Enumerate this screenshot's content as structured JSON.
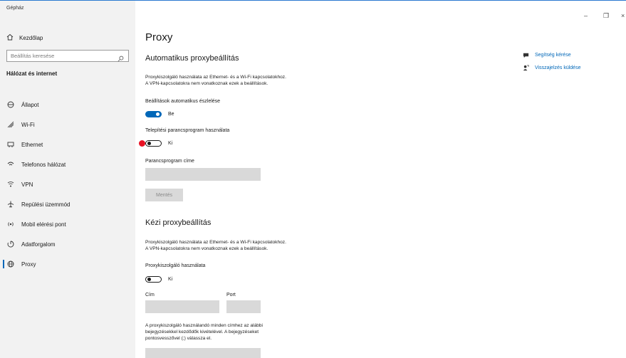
{
  "window": {
    "title": "Gépház",
    "minimize": "–",
    "restore": "❐",
    "close": "×"
  },
  "sidebar": {
    "home_label": "Kezdőlap",
    "search_placeholder": "Beállítás keresése",
    "section_title": "Hálózat és internet",
    "items": [
      {
        "label": "Állapot",
        "icon": "status-icon"
      },
      {
        "label": "Wi-Fi",
        "icon": "wifi-icon"
      },
      {
        "label": "Ethernet",
        "icon": "ethernet-icon"
      },
      {
        "label": "Telefonos hálózat",
        "icon": "dialup-icon"
      },
      {
        "label": "VPN",
        "icon": "vpn-icon"
      },
      {
        "label": "Repülési üzemmód",
        "icon": "airplane-icon"
      },
      {
        "label": "Mobil elérési pont",
        "icon": "hotspot-icon"
      },
      {
        "label": "Adatforgalom",
        "icon": "data-usage-icon"
      },
      {
        "label": "Proxy",
        "icon": "globe-icon",
        "selected": true
      }
    ]
  },
  "main": {
    "title": "Proxy",
    "auto": {
      "heading": "Automatikus proxybeállítás",
      "desc1": "Proxykiszolgáló használata az Ethernet- és a Wi-Fi kapcsolatokhoz.",
      "desc2": "A VPN-kapcsolatokra nem vonatkoznak ezek a beállítások.",
      "detect_label": "Beállítások automatikus észlelése",
      "detect_state": "Be",
      "script_label": "Telepítési parancsprogram használata",
      "script_state": "Ki",
      "address_label": "Parancsprogram címe",
      "save_label": "Mentés"
    },
    "manual": {
      "heading": "Kézi proxybeállítás",
      "desc1": "Proxykiszolgáló használata az Ethernet- és a Wi-Fi kapcsolatokhoz.",
      "desc2": "A VPN-kapcsolatokra nem vonatkoznak ezek a beállítások.",
      "use_label": "Proxykiszolgáló használata",
      "use_state": "Ki",
      "address_label": "Cím",
      "port_label": "Port",
      "exceptions1": "A proxykiszolgáló használandó minden címhez az alábbi",
      "exceptions2": "bejegyzésekkel kezdődők kivételével. A bejegyzéseket",
      "exceptions3": "pontosvesszővel (;) válassza el."
    },
    "help": {
      "get_help": "Segítség kérése",
      "feedback": "Visszajelzés küldése"
    }
  },
  "colors": {
    "accent": "#0067b8",
    "sidebar_bg": "#f2f2f2",
    "input_bg": "#d9d9d9",
    "marker": "#e81123"
  }
}
